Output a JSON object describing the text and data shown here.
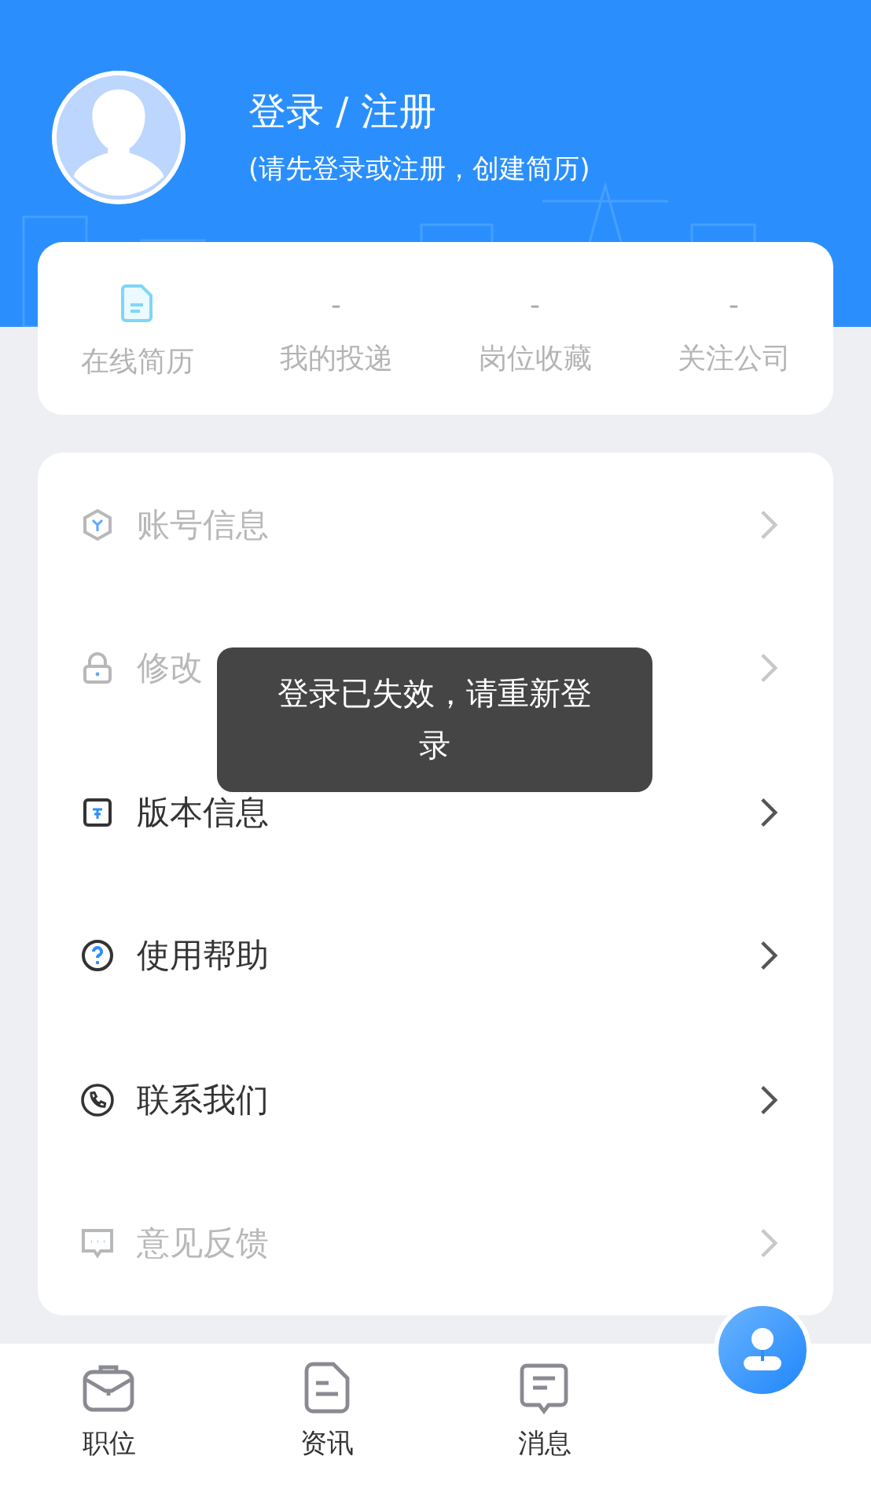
{
  "header": {
    "title": "登录 / 注册",
    "subtitle": "(请先登录或注册，创建简历)"
  },
  "stats": [
    {
      "kind": "icon",
      "label": "在线简历"
    },
    {
      "kind": "value",
      "value": "-",
      "label": "我的投递"
    },
    {
      "kind": "value",
      "value": "-",
      "label": "岗位收藏"
    },
    {
      "kind": "value",
      "value": "-",
      "label": "关注公司"
    }
  ],
  "menu": [
    {
      "label": "账号信息",
      "disabled": true
    },
    {
      "label": "修改",
      "disabled": true
    },
    {
      "label": "版本信息",
      "disabled": false
    },
    {
      "label": "使用帮助",
      "disabled": false
    },
    {
      "label": "联系我们",
      "disabled": false
    },
    {
      "label": "意见反馈",
      "disabled": true
    }
  ],
  "toast": "登录已失效，请重新登录",
  "tabs": [
    {
      "kind": "plain",
      "label": "职位",
      "selected": false
    },
    {
      "kind": "plain",
      "label": "资讯",
      "selected": false
    },
    {
      "kind": "plain",
      "label": "消息",
      "selected": false
    },
    {
      "kind": "raised",
      "selected": true
    }
  ]
}
